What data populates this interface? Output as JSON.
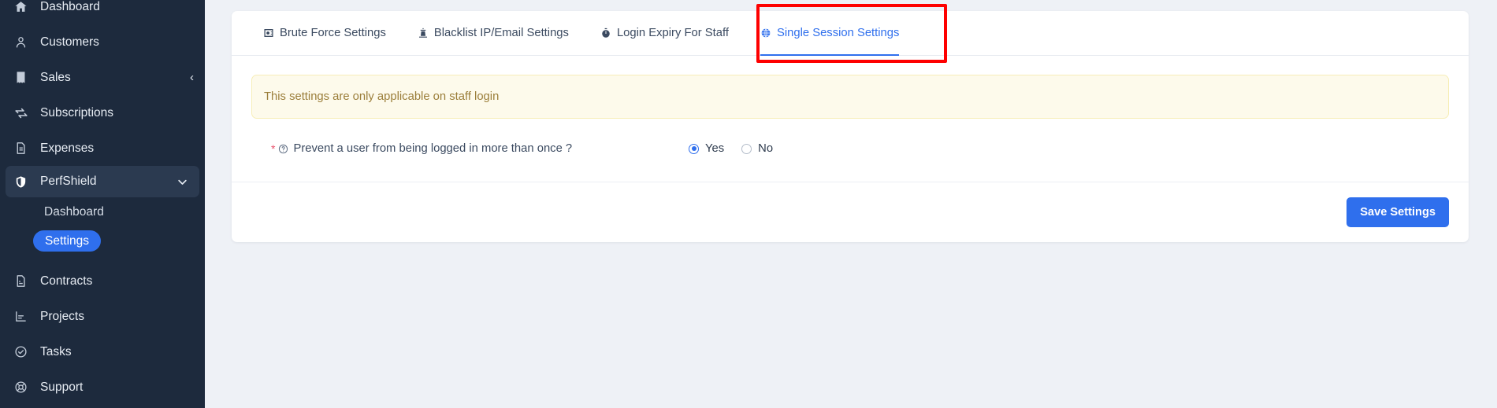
{
  "sidebar": {
    "items": [
      {
        "label": "Dashboard",
        "icon": "home-icon",
        "type": "item",
        "partial_top": true
      },
      {
        "label": "Customers",
        "icon": "user-icon",
        "type": "item"
      },
      {
        "label": "Sales",
        "icon": "receipt-icon",
        "type": "item",
        "chevron": "‹"
      },
      {
        "label": "Subscriptions",
        "icon": "refresh-cycle-icon",
        "type": "item"
      },
      {
        "label": "Expenses",
        "icon": "document-icon",
        "type": "item"
      },
      {
        "label": "PerfShield",
        "icon": "shield-icon",
        "type": "parent",
        "active": true,
        "chevron": "chevron-down-icon"
      },
      {
        "label": "Dashboard",
        "icon": "",
        "type": "sub"
      },
      {
        "label": "Settings",
        "icon": "",
        "type": "sub-pill",
        "active": true
      },
      {
        "label": "Contracts",
        "icon": "contract-icon",
        "type": "item"
      },
      {
        "label": "Projects",
        "icon": "bar-chart-icon",
        "type": "item"
      },
      {
        "label": "Tasks",
        "icon": "check-circle-icon",
        "type": "item"
      },
      {
        "label": "Support",
        "icon": "lifebuoy-icon",
        "type": "item"
      }
    ]
  },
  "tabs": [
    {
      "label": "Brute Force Settings",
      "icon": "safe-vault-icon",
      "active": false
    },
    {
      "label": "Blacklist IP/Email Settings",
      "icon": "lighthouse-icon",
      "active": false
    },
    {
      "label": "Login Expiry For Staff",
      "icon": "stopwatch-icon",
      "active": false
    },
    {
      "label": "Single Session Settings",
      "icon": "globe-icon",
      "active": true
    }
  ],
  "alert": {
    "message": "This settings are only applicable on staff login"
  },
  "form": {
    "required_mark": "*",
    "help_icon": "question-circle-icon",
    "question": "Prevent a user from being logged in more than once ?",
    "options": [
      {
        "label": "Yes",
        "selected": true
      },
      {
        "label": "No",
        "selected": false
      }
    ]
  },
  "footer": {
    "save_label": "Save Settings"
  },
  "colors": {
    "accent": "#2f6fed",
    "sidebar_bg": "#1d2a3d",
    "page_bg": "#eef1f6",
    "alert_bg": "#fdfaeb",
    "alert_text": "#9b7e3a",
    "annotation": "#fe0000",
    "required": "#e8506b"
  }
}
